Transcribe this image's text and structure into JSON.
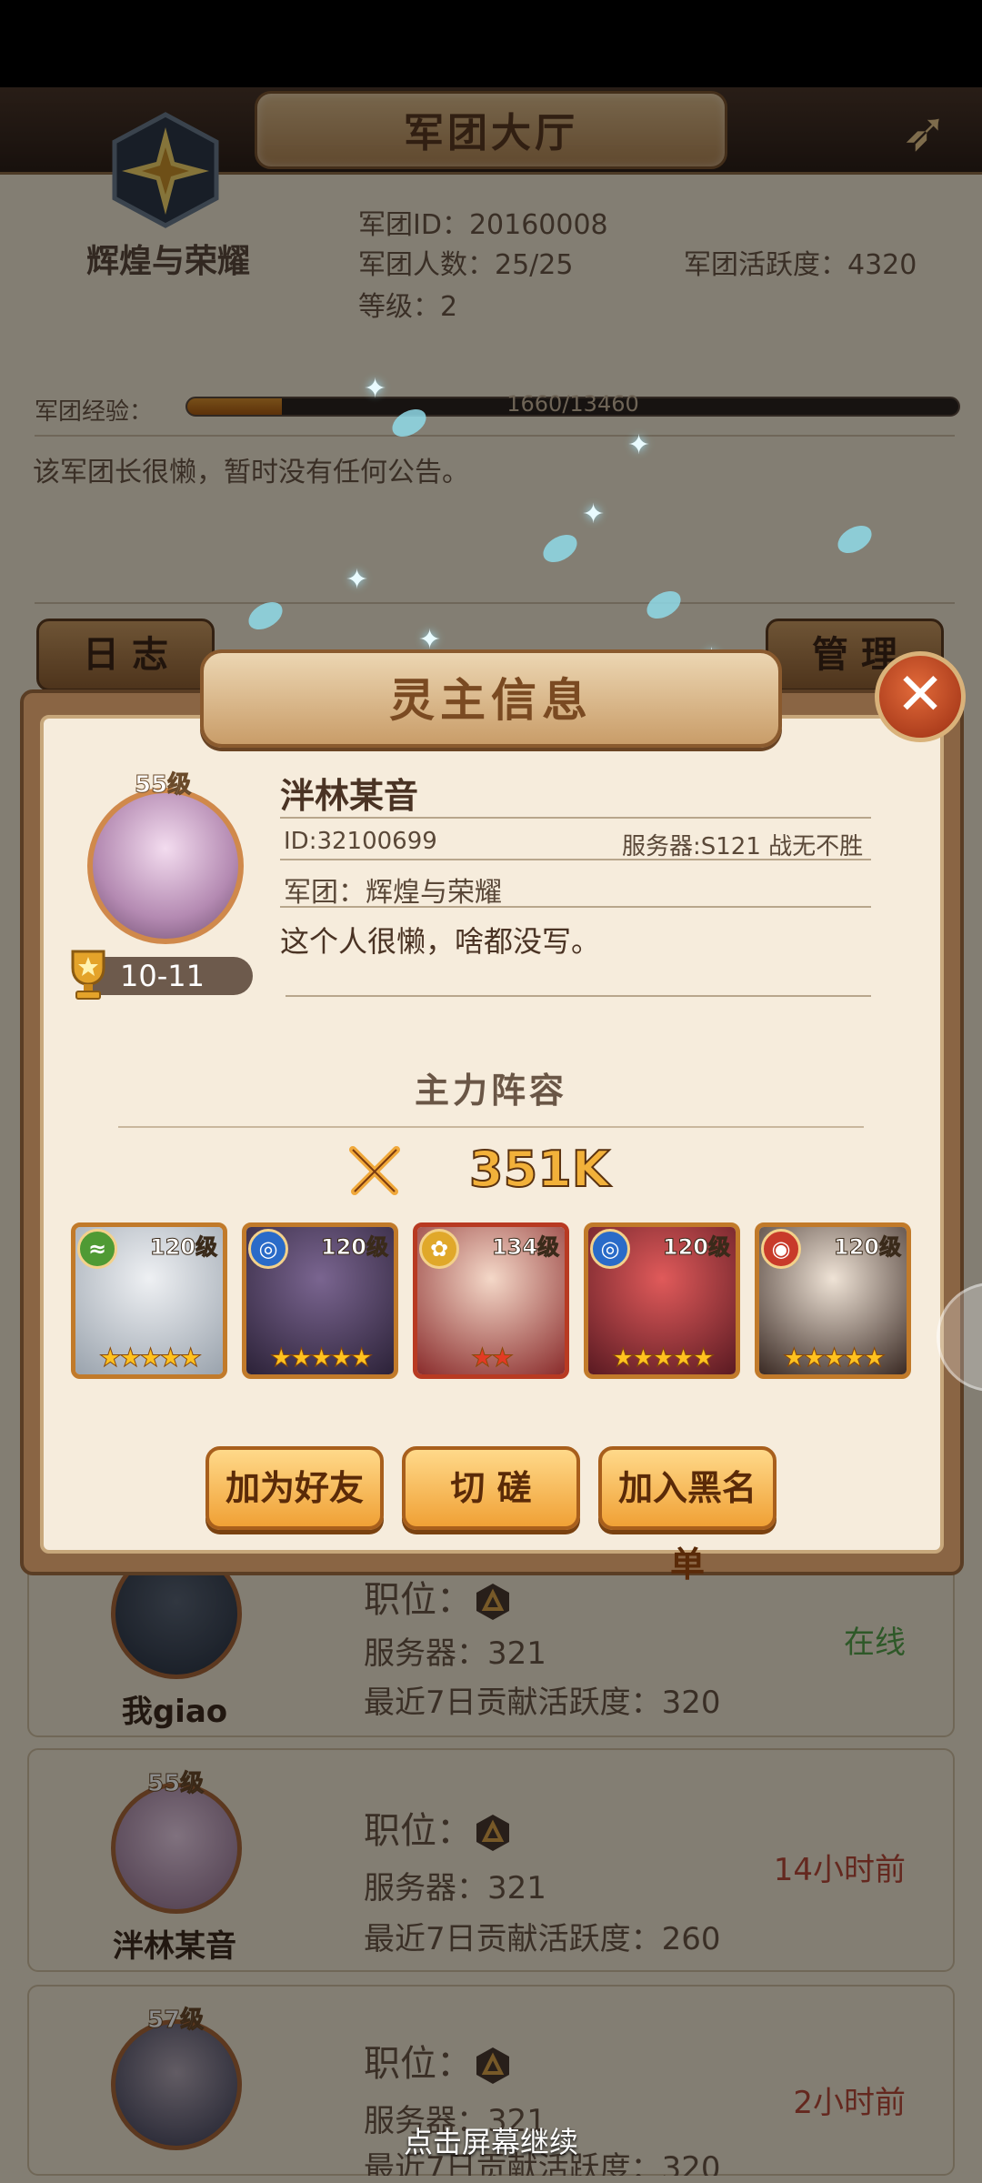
{
  "header": {
    "title": "军团大厅",
    "back_icon": "bow-arrow-icon"
  },
  "guild": {
    "name": "辉煌与荣耀",
    "id_line": "军团ID：20160008",
    "members_line": "军团人数：25/25",
    "level_line": "等级：2",
    "activity_line": "军团活跃度：4320",
    "exp_label": "军团经验：",
    "exp_text": "1660/13460",
    "exp_fraction": 0.123,
    "notice": "该军团长很懒，暂时没有任何公告。",
    "log_button": "日 志",
    "manage_button": "管 理"
  },
  "members": [
    {
      "name": "我giao",
      "level": "",
      "position_label": "职位：",
      "server": "服务器：321",
      "contribution": "最近7日贡献活跃度：320",
      "status": "在线",
      "status_type": "online"
    },
    {
      "name": "泮林某音",
      "level": "55级",
      "position_label": "职位：",
      "server": "服务器：321",
      "contribution": "最近7日贡献活跃度：260",
      "status": "14小时前",
      "status_type": "offline"
    },
    {
      "name": "",
      "level": "57级",
      "position_label": "职位：",
      "server": "服务器：321",
      "contribution": "最近7日贡献活跃度：320",
      "status": "2小时前",
      "status_type": "offline"
    }
  ],
  "dialog": {
    "title": "灵主信息",
    "close_icon": "close-icon",
    "player": {
      "level": "55级",
      "rank": "10-11",
      "name": "泮林某音",
      "id": "ID:32100699",
      "server": "服务器:S121 战无不胜",
      "guild": "军团：辉煌与荣耀",
      "signature": "这个人很懒，啥都没写。"
    },
    "lineup_title": "主力阵容",
    "power": "351K",
    "heroes": [
      {
        "level": "120级",
        "element": "wind",
        "element_glyph": "≈",
        "stars": 5,
        "star_color": "gold",
        "art": [
          "#eef0f3",
          "#9aa3ad"
        ],
        "frame": "#c17a2a"
      },
      {
        "level": "120级",
        "element": "water",
        "element_glyph": "◎",
        "stars": 5,
        "star_color": "gold",
        "art": [
          "#7a6590",
          "#2c2238"
        ],
        "frame": "#c17a2a"
      },
      {
        "level": "134级",
        "element": "light",
        "element_glyph": "✿",
        "stars": 2,
        "star_color": "red",
        "art": [
          "#f4d8c8",
          "#8a2c2c"
        ],
        "frame": "#b83a22"
      },
      {
        "level": "120级",
        "element": "water",
        "element_glyph": "◎",
        "stars": 5,
        "star_color": "gold",
        "art": [
          "#e05a5a",
          "#5a1a22"
        ],
        "frame": "#c17a2a"
      },
      {
        "level": "120级",
        "element": "fire",
        "element_glyph": "◉",
        "stars": 5,
        "star_color": "gold",
        "art": [
          "#efe3d6",
          "#3a2a24"
        ],
        "frame": "#c17a2a"
      }
    ],
    "buttons": {
      "add_friend": "加为好友",
      "spar": "切 磋",
      "blacklist": "加入黑名单"
    }
  },
  "hint": "点击屏幕继续"
}
